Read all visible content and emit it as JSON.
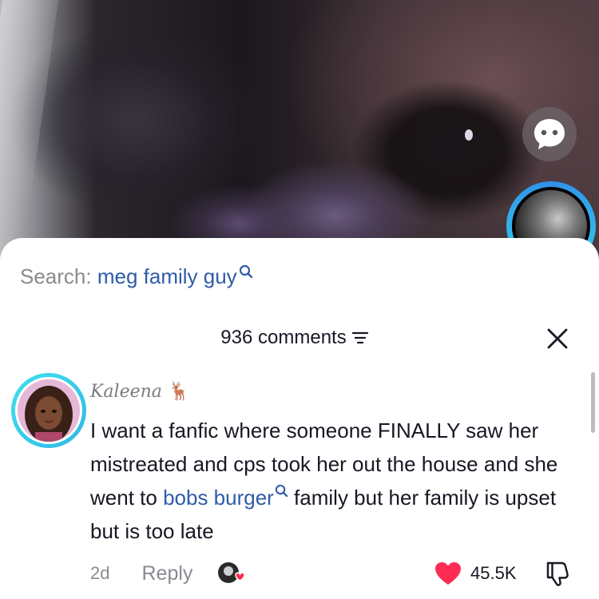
{
  "search": {
    "label": "Search:",
    "term": "meg family guy"
  },
  "comments_header": {
    "count_label": "936 comments"
  },
  "comment": {
    "username": "Kaleena",
    "username_emoji": "🦌",
    "text_parts": {
      "before_link": "I want a fanfic where someone FINALLY saw her mistreated and cps took her out the house and she went to ",
      "link": "bobs burger",
      "after_link": " family but her family is upset but is too late"
    },
    "age": "2d",
    "reply_label": "Reply",
    "like_count": "45.5K"
  },
  "colors": {
    "link_blue": "#2e5ca8",
    "like_red": "#fe2c55",
    "ring_cyan": "#41e0ea"
  },
  "icons": {
    "chat": "chat-bubble-icon",
    "search": "search-icon",
    "sort": "sort-icon",
    "close": "close-icon",
    "heart": "heart-icon",
    "dislike": "thumbs-down-icon"
  }
}
